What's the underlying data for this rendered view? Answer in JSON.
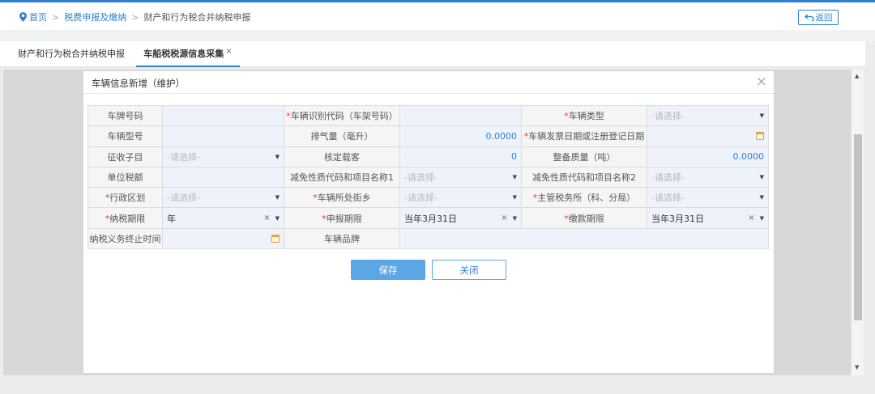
{
  "breadcrumb": {
    "home": "首页",
    "level2": "税费申报及缴纳",
    "current": "财产和行为税合并纳税申报",
    "separator": ">"
  },
  "back_button": {
    "label": "返回",
    "icon": "return-arrow-icon"
  },
  "tabs": [
    {
      "label": "财产和行为税合并纳税申报",
      "active": false
    },
    {
      "label": "车船税税源信息采集",
      "active": true,
      "close": "×"
    }
  ],
  "dialog": {
    "title": "车辆信息新增（维护）",
    "close": "×",
    "required_mark": "*",
    "rows": [
      [
        {
          "label": "车牌号码",
          "required": false,
          "type": "text",
          "value": ""
        },
        {
          "label": "车辆识别代码（车架号码）",
          "required": true,
          "type": "text",
          "value": ""
        },
        {
          "label": "车辆类型",
          "required": true,
          "type": "select",
          "placeholder": "-请选择-"
        }
      ],
      [
        {
          "label": "车辆型号",
          "required": false,
          "type": "text",
          "value": ""
        },
        {
          "label": "排气量（毫升）",
          "required": false,
          "type": "number",
          "value": "0.0000"
        },
        {
          "label": "车辆发票日期或注册登记日期",
          "required": true,
          "type": "date",
          "value": ""
        }
      ],
      [
        {
          "label": "征收子目",
          "required": false,
          "type": "select",
          "placeholder": "-请选择-"
        },
        {
          "label": "核定载客",
          "required": false,
          "type": "number",
          "value": "0"
        },
        {
          "label": "整备质量（吨）",
          "required": false,
          "type": "number",
          "value": "0.0000"
        }
      ],
      [
        {
          "label": "单位税额",
          "required": false,
          "type": "text",
          "value": ""
        },
        {
          "label": "减免性质代码和项目名称1",
          "required": false,
          "type": "select",
          "placeholder": "-请选择-"
        },
        {
          "label": "减免性质代码和项目名称2",
          "required": false,
          "type": "select",
          "placeholder": "-请选择-"
        }
      ],
      [
        {
          "label": "行政区划",
          "required": true,
          "type": "select",
          "placeholder": "-请选择-"
        },
        {
          "label": "车辆所处街乡",
          "required": true,
          "type": "select",
          "placeholder": "-请选择-"
        },
        {
          "label": "主管税务所（科、分局）",
          "required": true,
          "type": "select",
          "placeholder": "-请选择-"
        }
      ],
      [
        {
          "label": "纳税期限",
          "required": true,
          "type": "select",
          "value": "年"
        },
        {
          "label": "申报期限",
          "required": true,
          "type": "select",
          "value": "当年3月31日"
        },
        {
          "label": "缴款期限",
          "required": true,
          "type": "select",
          "value": "当年3月31日"
        }
      ]
    ],
    "last_row": {
      "label1": "纳税义务终止时间",
      "label2": "车辆品牌"
    },
    "clear_glyph": "×",
    "save_label": "保存",
    "close_label": "关闭"
  },
  "colors": {
    "accent": "#2f7fd6",
    "required": "#e53935",
    "input_bg": "#eef3fb",
    "save_bg": "#5ba7e6"
  }
}
